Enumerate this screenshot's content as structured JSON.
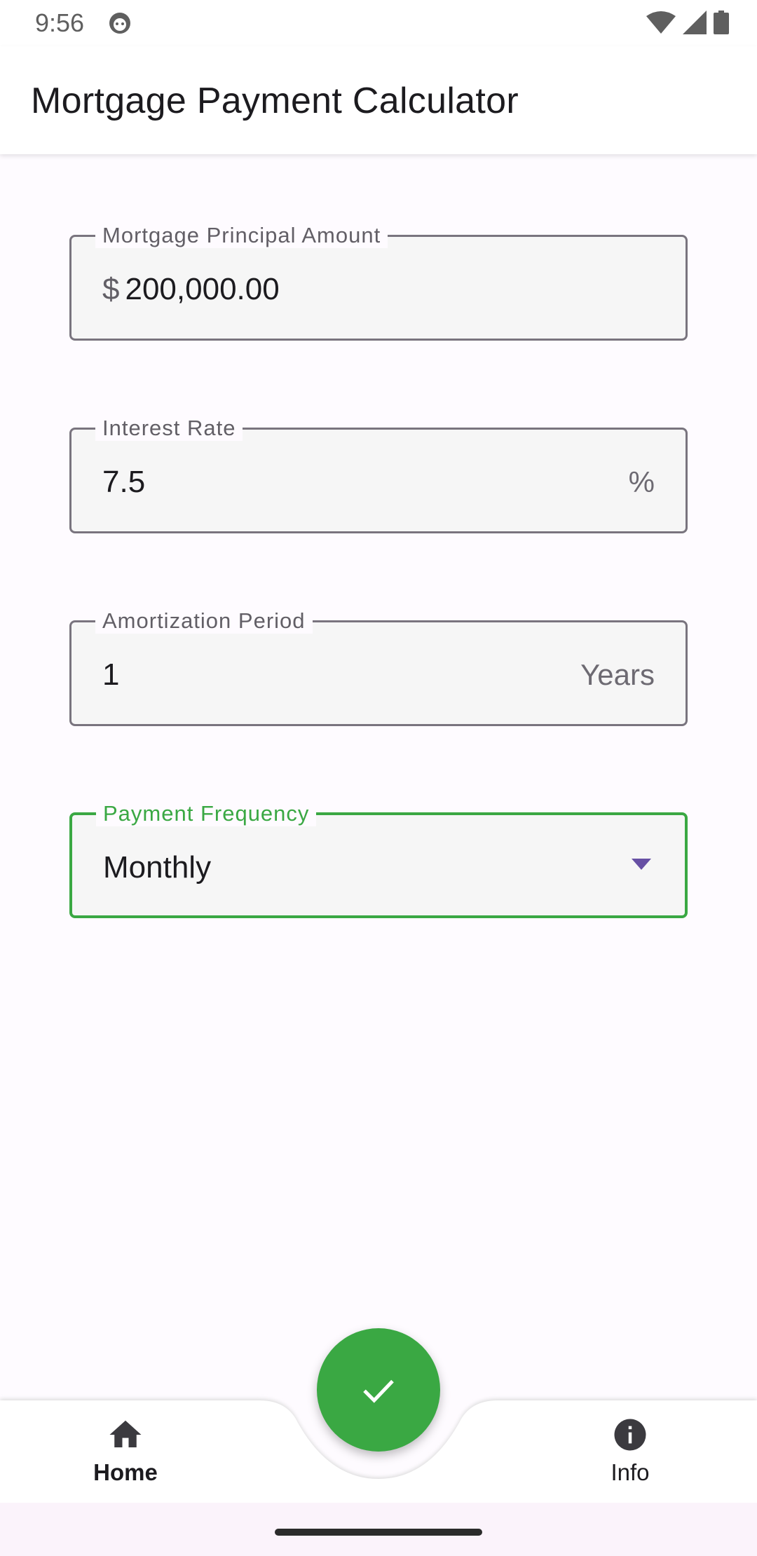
{
  "status_bar": {
    "time": "9:56",
    "icons": [
      "app-notification-icon",
      "wifi-icon",
      "signal-icon",
      "battery-icon"
    ]
  },
  "app_bar": {
    "title": "Mortgage Payment Calculator"
  },
  "form": {
    "principal": {
      "label": "Mortgage Principal Amount",
      "prefix": "$",
      "value": "200,000.00"
    },
    "interest_rate": {
      "label": "Interest Rate",
      "value": "7.5",
      "suffix": "%"
    },
    "amortization": {
      "label": "Amortization Period",
      "value": "1",
      "suffix": "Years"
    },
    "frequency": {
      "label": "Payment Frequency",
      "selected": "Monthly"
    }
  },
  "fab": {
    "icon": "check-icon"
  },
  "bottom_nav": {
    "items": [
      {
        "label": "Home",
        "icon": "home-icon",
        "active": true
      },
      {
        "label": "Info",
        "icon": "info-icon",
        "active": false
      }
    ]
  },
  "colors": {
    "accent": "#3aa843",
    "dropdown_arrow": "#6750a4",
    "outline": "#79747e"
  }
}
